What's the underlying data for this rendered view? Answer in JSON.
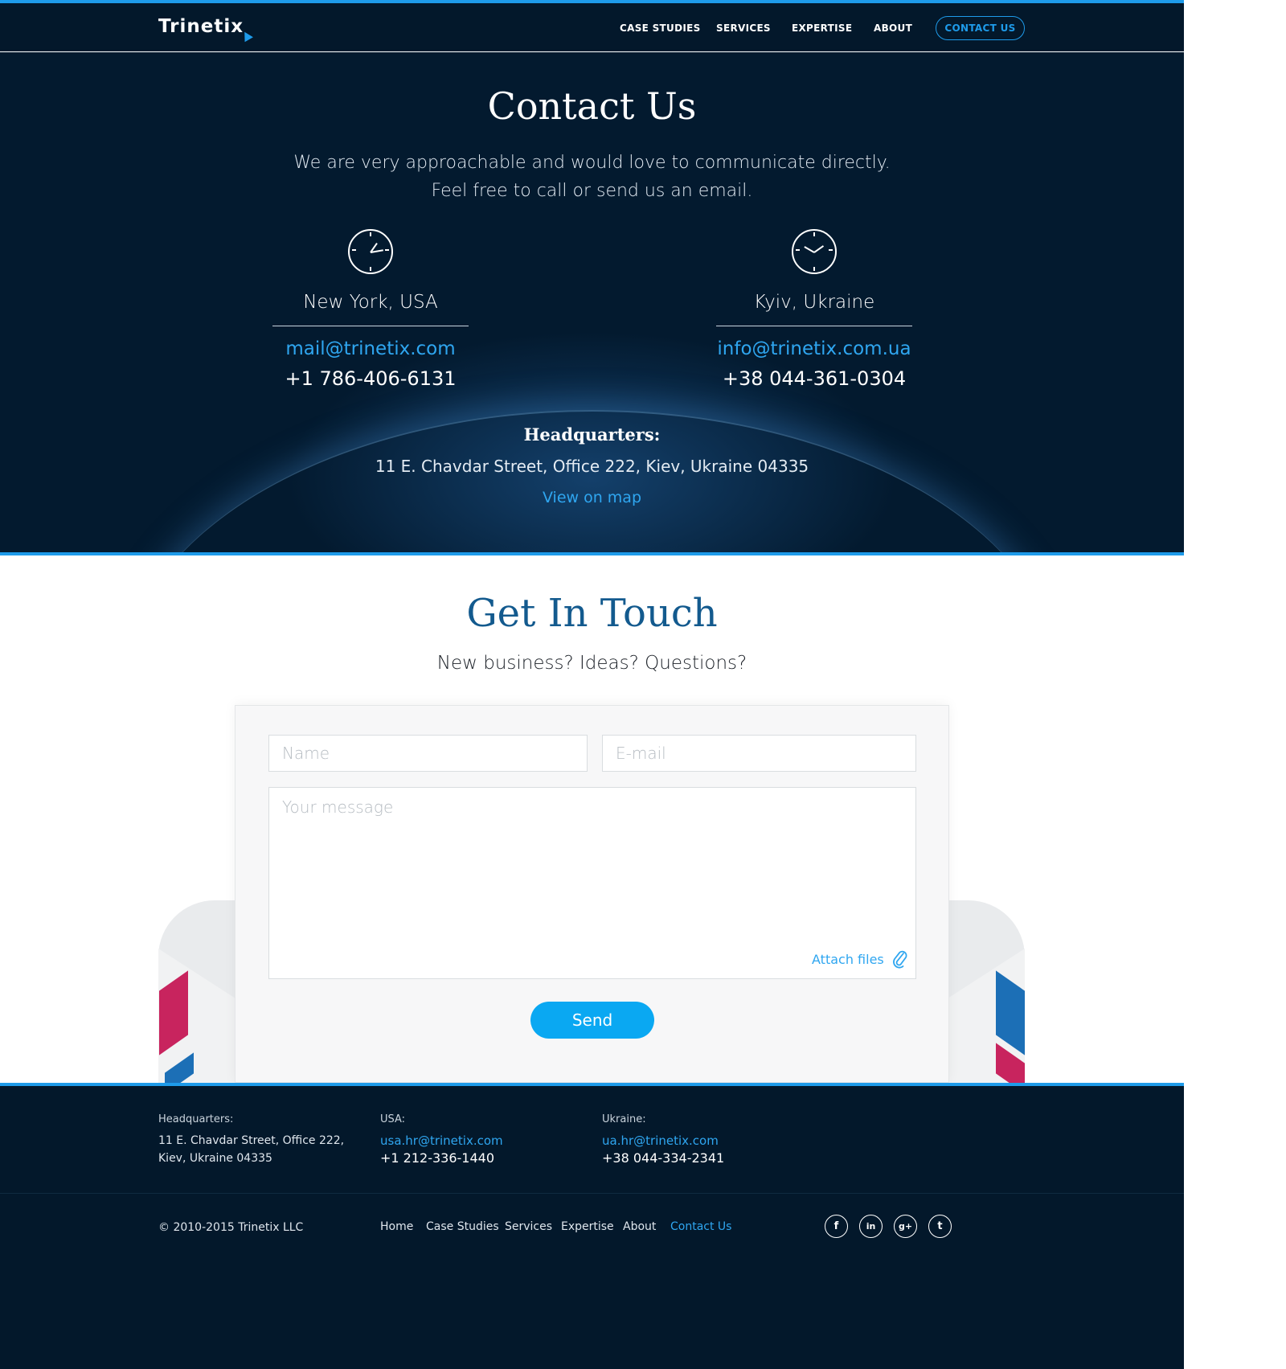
{
  "header": {
    "logo": "Trinetix",
    "nav": [
      "CASE STUDIES",
      "SERVICES",
      "EXPERTISE",
      "ABOUT"
    ],
    "contact_button": "CONTACT US"
  },
  "hero": {
    "title": "Contact Us",
    "subtitle_line1": "We are very approachable and would love to communicate directly.",
    "subtitle_line2": "Feel free to call or send us an email.",
    "offices": [
      {
        "city": "New York, USA",
        "email": "mail@trinetix.com",
        "phone": "+1 786-406-6131"
      },
      {
        "city": "Kyiv, Ukraine",
        "email": "info@trinetix.com.ua",
        "phone": "+38 044-361-0304"
      }
    ],
    "hq_title": "Headquarters:",
    "hq_address": "11 E. Chavdar Street, Office 222, Kiev, Ukraine 04335",
    "view_map": "View on map"
  },
  "touch": {
    "title": "Get In Touch",
    "subtitle": "New business? Ideas? Questions?",
    "name_placeholder": "Name",
    "email_placeholder": "E-mail",
    "message_placeholder": "Your message",
    "attach": "Attach files",
    "send": "Send"
  },
  "footer": {
    "hq_label": "Headquarters:",
    "hq_line1": "11 E. Chavdar Street, Office 222,",
    "hq_line2": "Kiev, Ukraine 04335",
    "usa_label": "USA:",
    "usa_email": "usa.hr@trinetix.com",
    "usa_phone": "+1 212-336-1440",
    "ua_label": "Ukraine:",
    "ua_email": "ua.hr@trinetix.com",
    "ua_phone": "+38 044-334-2341",
    "copyright": "© 2010-2015 Trinetix LLC",
    "links": [
      "Home",
      "Case Studies",
      "Services",
      "Expertise",
      "About",
      "Contact Us"
    ],
    "social": [
      "f",
      "in",
      "g+",
      "t"
    ]
  },
  "colors": {
    "accent": "#1e9bea",
    "dark_bg": "#03182b",
    "link_blue": "#2fa6f0",
    "title_blue": "#135a8e",
    "send_blue": "#0aa8f2"
  },
  "icons": {
    "clock": "clock-icon",
    "paperclip": "paperclip-icon",
    "facebook": "facebook-icon",
    "linkedin": "linkedin-icon",
    "google_plus": "google-plus-icon",
    "twitter": "twitter-icon"
  }
}
